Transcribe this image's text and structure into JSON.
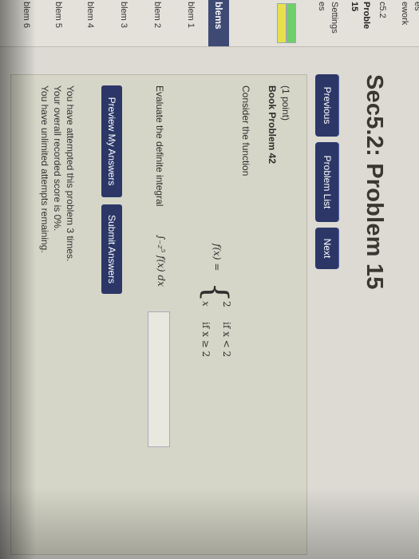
{
  "sidebar": {
    "top_label": "es",
    "homework_label": "ework",
    "set_label": "c5.2",
    "problem_label": "Proble",
    "problem_number": "15",
    "settings_label": "Settings",
    "settings_sub": "es",
    "problems_header": "blems",
    "problems": [
      "blem 1",
      "blem 2",
      "blem 3",
      "blem 4",
      "blem 5",
      "blem 6"
    ],
    "progress_colors": [
      "#6fcf6a",
      "#e6e04e"
    ]
  },
  "header": {
    "title": "Sec5.2: Problem 15"
  },
  "nav": {
    "previous": "Previous",
    "problem_list": "Problem List",
    "next": "Next"
  },
  "problem": {
    "points": "(1 point)",
    "book": "Book Problem 42",
    "intro": "Consider the function",
    "fx": "f(x) = ",
    "case1_val": "2",
    "case1_cond": "if x < 2",
    "case2_val": "x",
    "case2_cond": "if x ≥ 2",
    "question": "Evaluate the definite integral",
    "integral": "∫₋₂⁵ f(x) dx",
    "answer_value": ""
  },
  "actions": {
    "preview": "Preview My Answers",
    "submit": "Submit Answers"
  },
  "status": {
    "attempted": "You have attempted this problem 3 times.",
    "score": "Your overall recorded score is 0%.",
    "remaining": "You have unlimited attempts remaining."
  },
  "colors": {
    "button": "#2c3768",
    "panel": "#d6d6c8"
  }
}
